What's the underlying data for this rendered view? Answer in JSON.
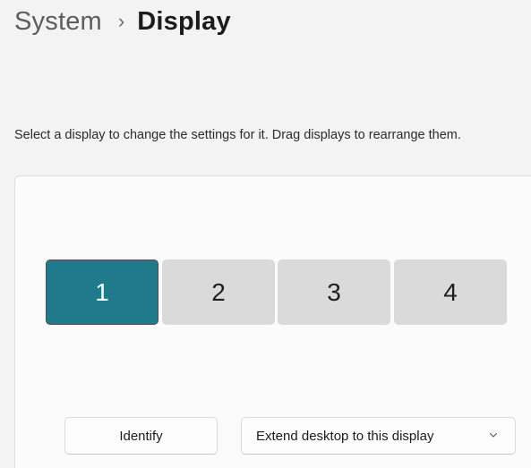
{
  "breadcrumb": {
    "parent": "System",
    "separator": "›",
    "current": "Display"
  },
  "instructions": "Select a display to change the settings for it. Drag displays to rearrange them.",
  "displays": [
    {
      "label": "1",
      "selected": true
    },
    {
      "label": "2",
      "selected": false
    },
    {
      "label": "3",
      "selected": false
    },
    {
      "label": "4",
      "selected": false
    }
  ],
  "buttons": {
    "identify_label": "Identify",
    "multiple_displays_value": "Extend desktop to this display"
  },
  "icons": {
    "dropdown": "chevron-down-icon"
  },
  "colors": {
    "selected_display": "#1f7a8c",
    "unselected_display": "#dadada"
  }
}
